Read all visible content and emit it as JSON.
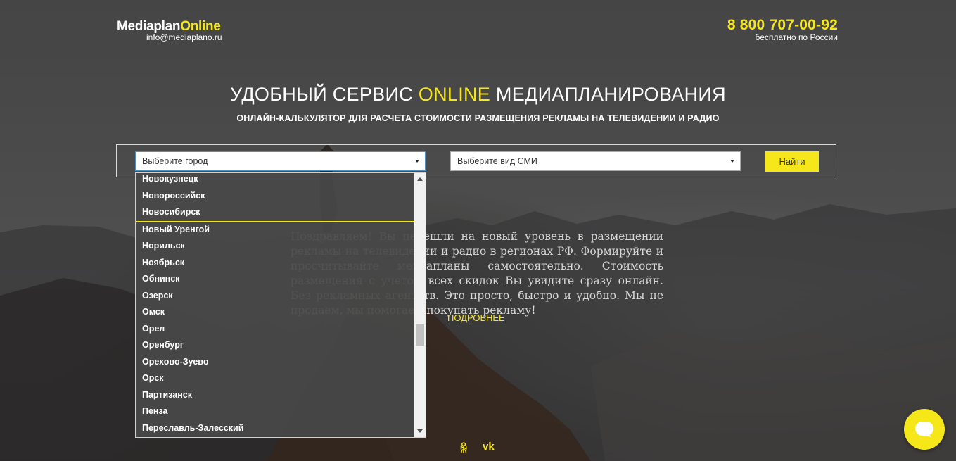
{
  "header": {
    "logo_main": "Mediaplan",
    "logo_accent": "Online",
    "email": "info@mediaplano.ru",
    "phone": "8 800 707-00-92",
    "phone_note": "бесплатно по России"
  },
  "hero": {
    "title_before": "УДОБНЫЙ СЕРВИС ",
    "title_accent": "ONLINE",
    "title_after": " МЕДИАПЛАНИРОВАНИЯ",
    "subtitle": "ОНЛАЙН-КАЛЬКУЛЯТОР ДЛЯ РАСЧЕТА СТОИМОСТИ РАЗМЕЩЕНИЯ РЕКЛАМЫ НА ТЕЛЕВИДЕНИИ И РАДИО"
  },
  "search": {
    "city_select_value": "Выберите город",
    "media_select_value": "Выберите вид СМИ",
    "find_label": "Найти"
  },
  "city_dropdown": {
    "items": [
      "Новокузнецк",
      "Новороссийск",
      "Новосибирск",
      "Новый Уренгой",
      "Норильск",
      "Ноябрьск",
      "Обнинск",
      "Озерск",
      "Омск",
      "Орел",
      "Оренбург",
      "Орехово-Зуево",
      "Орск",
      "Партизанск",
      "Пенза",
      "Переславль-Залесский"
    ],
    "highlighted": "Новосибирск"
  },
  "intro": {
    "text": "Поздравляем! Вы перешли на новый уровень в размещении рекламы на телевидении и радио в регионах РФ. Формируйте и просчитывайте медиапланы самостоятельно. Стоимость размещения с учетом всех скидок Вы увидите сразу онлайн. Без рекламных агентств. Это просто, быстро и удобно. Мы не продаем, мы помогаем покупать рекламу!",
    "more_label": "ПОДРОБНЕЕ"
  },
  "social": {
    "ok_icon": "odnoklassniki-icon",
    "ok_glyph": "ꆜ",
    "vk_icon": "vk-icon",
    "vk_glyph": "vk"
  },
  "chat": {
    "icon": "chat-bubble-icon"
  },
  "colors": {
    "accent": "#f6e71b"
  }
}
